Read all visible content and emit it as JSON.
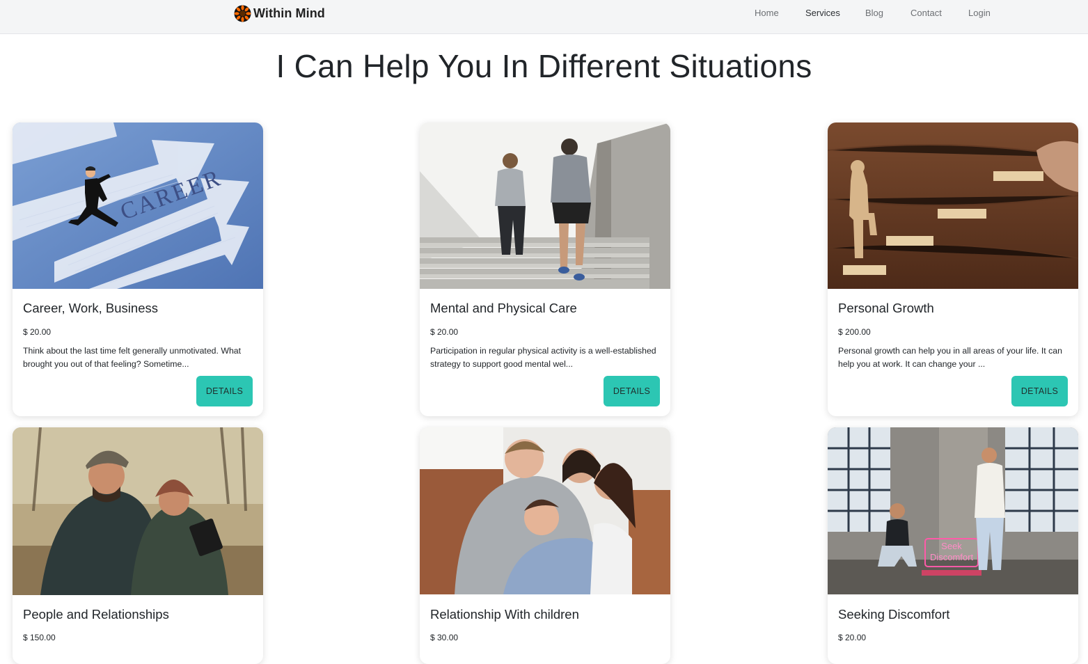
{
  "brand": {
    "name": "Within Mind",
    "logo_icon": "sunflower-logo-icon",
    "logo_colors": [
      "#ff6a00",
      "#111111"
    ]
  },
  "nav": {
    "home": "Home",
    "services": "Services",
    "blog": "Blog",
    "contact": "Contact",
    "login": "Login",
    "active": "Services"
  },
  "page": {
    "title": "I Can Help You In Different Situations"
  },
  "accent_color": "#2cc6b3",
  "cards": [
    {
      "title": "Career, Work, Business",
      "price": "$ 20.00",
      "description": "Think about the last time felt generally unmotivated. What brought you out of that feeling? Sometime...",
      "button": "DETAILS",
      "image_text": "CAREER"
    },
    {
      "title": "Mental and Physical Care",
      "price": "$ 20.00",
      "description": "Participation in regular physical activity is a well-established strategy to support good mental wel...",
      "button": "DETAILS"
    },
    {
      "title": "Personal Growth",
      "price": "$ 200.00",
      "description": "Personal growth can help you in all areas of your life. It can help you at work. It can change your ...",
      "button": "DETAILS"
    },
    {
      "title": "People and Relationships",
      "price": "$ 150.00"
    },
    {
      "title": "Relationship With children",
      "price": "$ 30.00"
    },
    {
      "title": "Seeking Discomfort",
      "price": "$ 20.00",
      "image_sign": [
        "Seek",
        "Discomfort"
      ]
    }
  ]
}
